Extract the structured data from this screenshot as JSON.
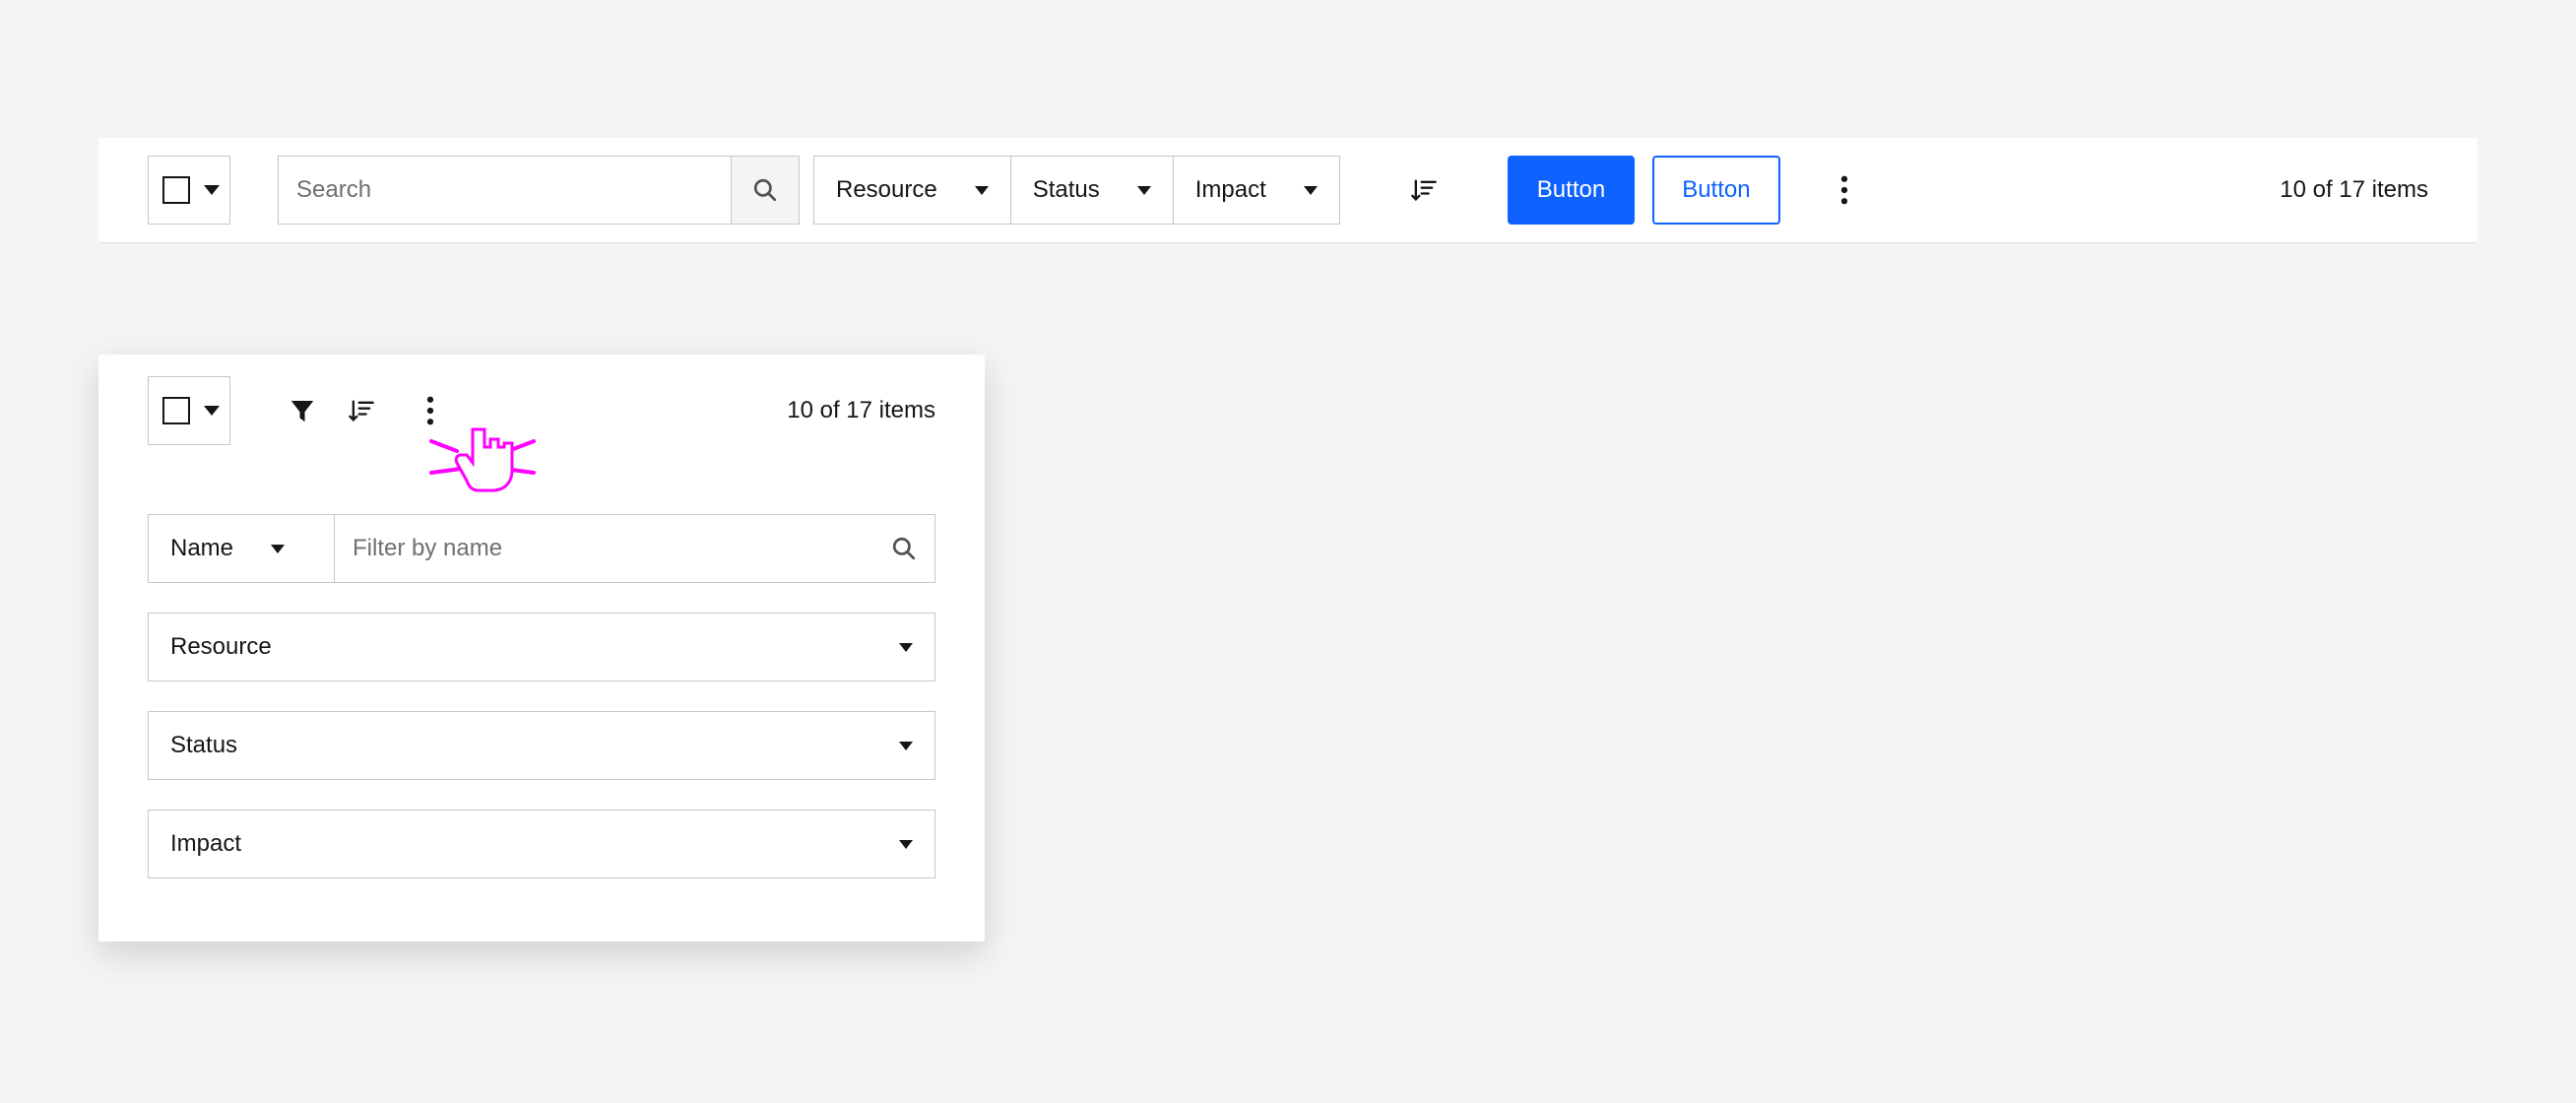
{
  "toolbar": {
    "search_placeholder": "Search",
    "filters": [
      {
        "label": "Resource"
      },
      {
        "label": "Status"
      },
      {
        "label": "Impact"
      }
    ],
    "primary_button_label": "Button",
    "secondary_button_label": "Button",
    "items_count_text": "10 of 17 items"
  },
  "compact": {
    "items_count_text": "10 of 17 items",
    "name_filter_label": "Name",
    "name_filter_placeholder": "Filter by name",
    "dropdowns": [
      {
        "label": "Resource"
      },
      {
        "label": "Status"
      },
      {
        "label": "Impact"
      }
    ]
  }
}
